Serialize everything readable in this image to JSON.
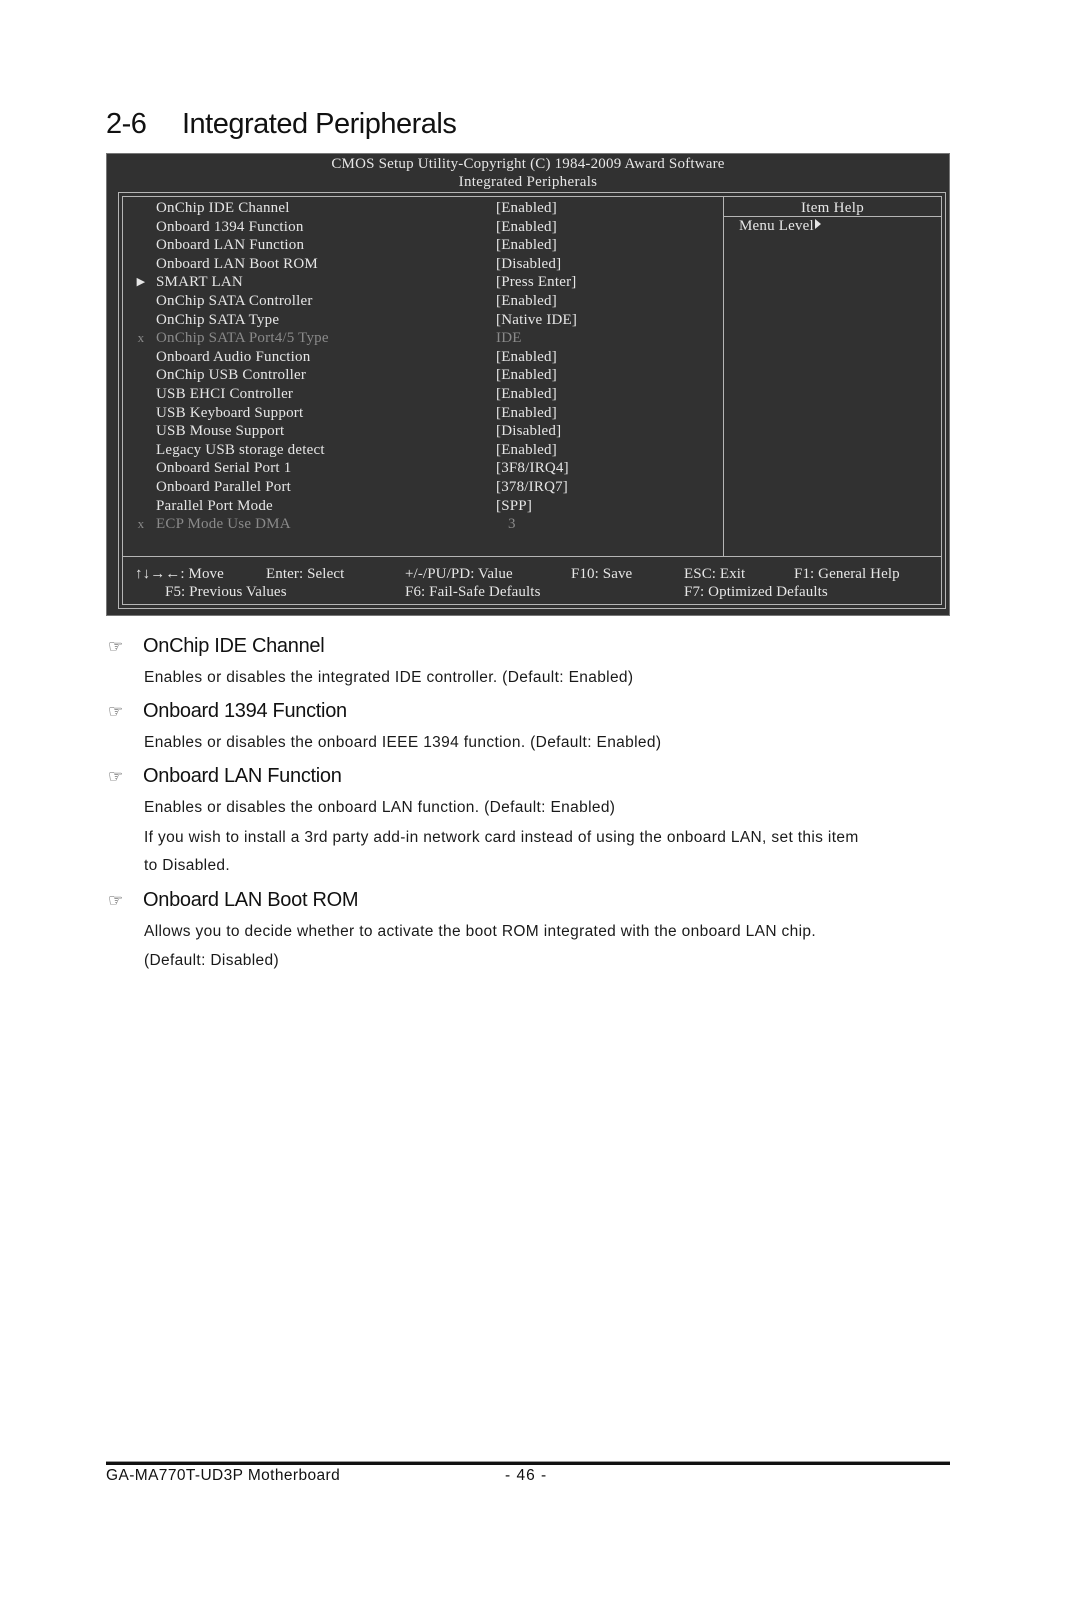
{
  "section": {
    "number": "2-6",
    "title": "Integrated Peripherals"
  },
  "bios": {
    "title": "CMOS Setup Utility-Copyright (C) 1984-2009 Award Software",
    "subtitle": "Integrated Peripherals",
    "items": [
      {
        "marker": "",
        "name": "OnChip IDE Channel",
        "value": "[Enabled]",
        "state": "normal"
      },
      {
        "marker": "",
        "name": "Onboard 1394 Function",
        "value": "[Enabled]",
        "state": "normal"
      },
      {
        "marker": "",
        "name": "Onboard LAN Function",
        "value": "[Enabled]",
        "state": "normal"
      },
      {
        "marker": "",
        "name": "Onboard LAN Boot ROM",
        "value": "[Disabled]",
        "state": "normal"
      },
      {
        "marker": "submenu",
        "name": "SMART LAN",
        "value": "[Press Enter]",
        "state": "normal"
      },
      {
        "marker": "",
        "name": "OnChip SATA Controller",
        "value": "[Enabled]",
        "state": "normal"
      },
      {
        "marker": "",
        "name": "OnChip SATA Type",
        "value": "[Native IDE]",
        "state": "normal"
      },
      {
        "marker": "x",
        "name": "OnChip SATA Port4/5 Type",
        "value": "IDE",
        "state": "disabled"
      },
      {
        "marker": "",
        "name": "Onboard Audio Function",
        "value": "[Enabled]",
        "state": "normal"
      },
      {
        "marker": "",
        "name": "OnChip USB Controller",
        "value": "[Enabled]",
        "state": "normal"
      },
      {
        "marker": "",
        "name": "USB EHCI Controller",
        "value": "[Enabled]",
        "state": "normal"
      },
      {
        "marker": "",
        "name": "USB Keyboard Support",
        "value": "[Enabled]",
        "state": "normal"
      },
      {
        "marker": "",
        "name": "USB Mouse Support",
        "value": "[Disabled]",
        "state": "normal"
      },
      {
        "marker": "",
        "name": "Legacy USB storage detect",
        "value": "[Enabled]",
        "state": "normal"
      },
      {
        "marker": "",
        "name": "Onboard Serial Port 1",
        "value": "[3F8/IRQ4]",
        "state": "normal"
      },
      {
        "marker": "",
        "name": "Onboard Parallel Port",
        "value": "[378/IRQ7]",
        "state": "normal"
      },
      {
        "marker": "",
        "name": "Parallel Port Mode",
        "value": "[SPP]",
        "state": "normal"
      },
      {
        "marker": "x",
        "name": "ECP Mode Use DMA",
        "value": "3",
        "state": "disabled"
      }
    ],
    "help": {
      "title": "Item Help",
      "menu_level": "Menu Level"
    },
    "keys": {
      "move": "↑↓→←: Move",
      "select": "Enter: Select",
      "value": "+/-/PU/PD: Value",
      "save": "F10: Save",
      "exit": "ESC: Exit",
      "general_help": "F1: General Help",
      "previous": "F5: Previous Values",
      "failsafe": "F6: Fail-Safe Defaults",
      "optimized": "F7: Optimized Defaults"
    }
  },
  "descriptions": [
    {
      "icon": "pointing-hand-icon",
      "title": "OnChip IDE Channel",
      "lines": [
        "Enables or disables the integrated IDE controller. (Default: Enabled)"
      ]
    },
    {
      "icon": "pointing-hand-icon",
      "title": "Onboard 1394 Function",
      "lines": [
        "Enables or disables the onboard IEEE 1394 function. (Default: Enabled)"
      ]
    },
    {
      "icon": "pointing-hand-icon",
      "title": "Onboard LAN Function",
      "lines": [
        "Enables or disables the onboard LAN function. (Default: Enabled)",
        "If you wish to install a 3rd party add-in network card instead of using the onboard LAN, set this item",
        "to Disabled."
      ]
    },
    {
      "icon": "pointing-hand-icon",
      "title": "Onboard LAN Boot ROM",
      "lines": [
        "Allows you to decide whether to activate the boot ROM integrated with the onboard LAN chip.",
        "(Default: Disabled)"
      ]
    }
  ],
  "footer": {
    "product": "GA-MA770T-UD3P Motherboard",
    "page": "- 46 -"
  }
}
